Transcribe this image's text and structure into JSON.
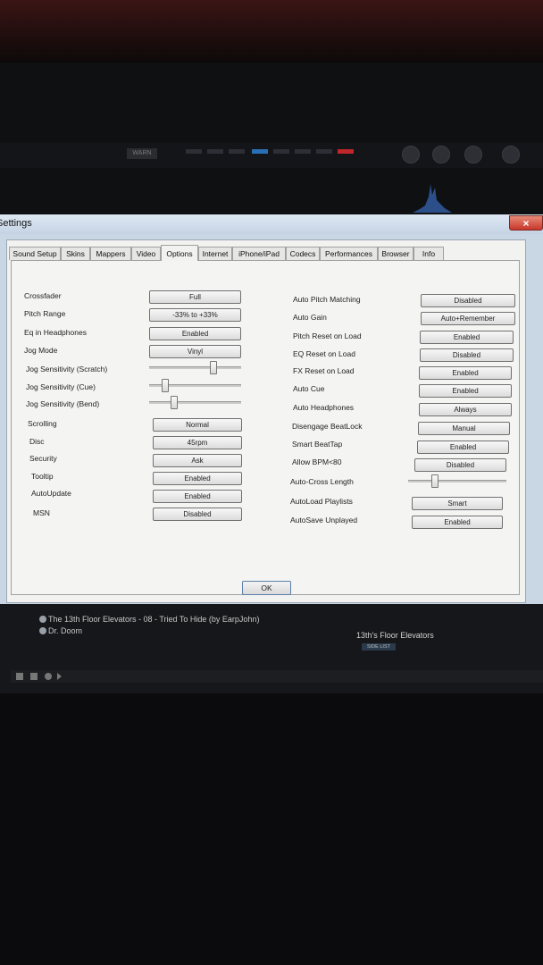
{
  "window": {
    "title": "Settings",
    "close_glyph": "×"
  },
  "deck": {
    "warn_label": "WARN"
  },
  "tabs": [
    "Sound Setup",
    "Skins",
    "Mappers",
    "Video",
    "Options",
    "Internet",
    "iPhone/iPad",
    "Codecs",
    "Performances",
    "Browser",
    "Info"
  ],
  "active_tab": "Options",
  "left": {
    "crossfader": {
      "label": "Crossfader",
      "value": "Full"
    },
    "pitch_range": {
      "label": "Pitch Range",
      "value": "-33% to +33%"
    },
    "eq_headphones": {
      "label": "Eq in Headphones",
      "value": "Enabled"
    },
    "jog_mode": {
      "label": "Jog Mode",
      "value": "Vinyl"
    },
    "jog_scratch": {
      "label": "Jog Sensitivity (Scratch)",
      "level": 0.72
    },
    "jog_cue": {
      "label": "Jog Sensitivity (Cue)",
      "level": 0.15
    },
    "jog_bend": {
      "label": "Jog Sensitivity (Bend)",
      "level": 0.25
    },
    "scrolling": {
      "label": "Scrolling",
      "value": "Normal"
    },
    "disc": {
      "label": "Disc",
      "value": "45rpm"
    },
    "security": {
      "label": "Security",
      "value": "Ask"
    },
    "tooltip": {
      "label": "Tooltip",
      "value": "Enabled"
    },
    "autoupdate": {
      "label": "AutoUpdate",
      "value": "Enabled"
    },
    "msn": {
      "label": "MSN",
      "value": "Disabled"
    }
  },
  "right": {
    "auto_pitch": {
      "label": "Auto Pitch Matching",
      "value": "Disabled"
    },
    "auto_gain": {
      "label": "Auto Gain",
      "value": "Auto+Remember"
    },
    "pitch_reset": {
      "label": "Pitch Reset on Load",
      "value": "Enabled"
    },
    "eq_reset": {
      "label": "EQ Reset on Load",
      "value": "Disabled"
    },
    "fx_reset": {
      "label": "FX Reset on Load",
      "value": "Enabled"
    },
    "auto_cue": {
      "label": "Auto Cue",
      "value": "Enabled"
    },
    "auto_headphones": {
      "label": "Auto Headphones",
      "value": "Always"
    },
    "disengage_beatlock": {
      "label": "Disengage BeatLock",
      "value": "Manual"
    },
    "smart_beattap": {
      "label": "Smart BeatTap",
      "value": "Enabled"
    },
    "allow_bpm": {
      "label": "Allow BPM<80",
      "value": "Disabled"
    },
    "auto_cross_length": {
      "label": "Auto-Cross Length",
      "level": 0.25
    },
    "autoload_playlists": {
      "label": "AutoLoad Playlists",
      "value": "Smart"
    },
    "autosave_unplayed": {
      "label": "AutoSave Unplayed",
      "value": "Enabled"
    }
  },
  "ok_label": "OK",
  "browser": {
    "rows": [
      "The 13th Floor Elevators - 08 - Tried To Hide (by EarpJohn)",
      "Dr. Doom"
    ],
    "side_title": "13th's Floor Elevators",
    "side_list_label": "SIDE LIST"
  },
  "colors": {
    "accent_blue": "#2a6fb5",
    "accent_red": "#c0262a",
    "window_frame": "#c9d6e4"
  }
}
